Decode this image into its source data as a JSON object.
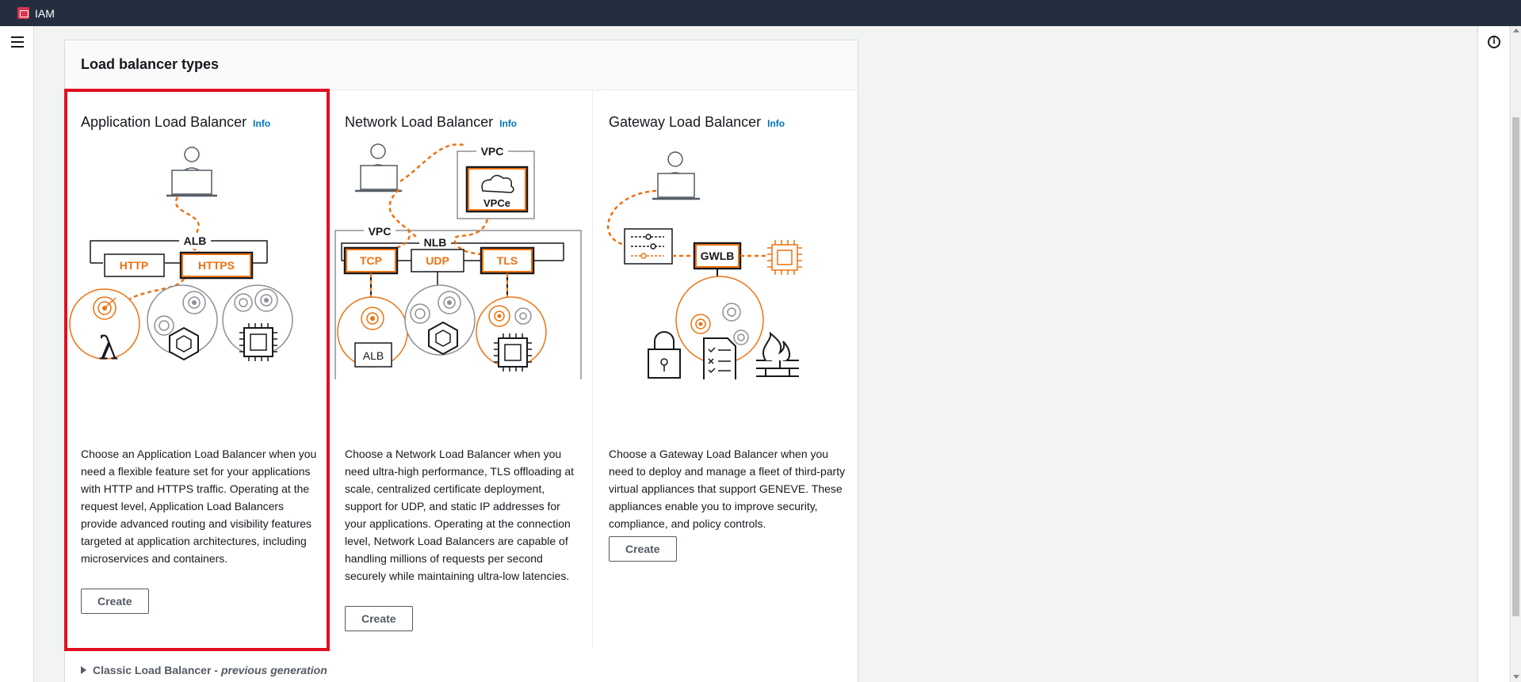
{
  "topbar": {
    "service_label": "IAM"
  },
  "panel": {
    "title": "Load balancer types"
  },
  "cards": [
    {
      "title": "Application Load Balancer",
      "info": "Info",
      "description": "Choose an Application Load Balancer when you need a flexible feature set for your applications with HTTP and HTTPS traffic. Operating at the request level, Application Load Balancers provide advanced routing and visibility features targeted at application architectures, including microservices and containers.",
      "create": "Create",
      "diagram": {
        "group": "ALB",
        "listener_1": "HTTP",
        "listener_2": "HTTPS"
      }
    },
    {
      "title": "Network Load Balancer",
      "info": "Info",
      "description": "Choose a Network Load Balancer when you need ultra-high performance, TLS offloading at scale, centralized certificate deployment, support for UDP, and static IP addresses for your applications. Operating at the connection level, Network Load Balancers are capable of handling millions of requests per second securely while maintaining ultra-low latencies.",
      "create": "Create",
      "diagram": {
        "vpc_top": "VPC",
        "vpce": "VPCe",
        "vpc": "VPC",
        "group": "NLB",
        "listener_1": "TCP",
        "listener_2": "UDP",
        "listener_3": "TLS",
        "target_label": "ALB"
      }
    },
    {
      "title": "Gateway Load Balancer",
      "info": "Info",
      "description": "Choose a Gateway Load Balancer when you need to deploy and manage a fleet of third-party virtual appliances that support GENEVE. These appliances enable you to improve security, compliance, and policy controls.",
      "create": "Create",
      "diagram": {
        "gateway": "GWLB"
      }
    }
  ],
  "classic": {
    "label": "Classic Load Balancer -",
    "sub": "previous generation"
  },
  "colors": {
    "accent": "#ec7211",
    "selection": "#e0101e",
    "link": "#0073bb",
    "topbar": "#232f3e"
  }
}
